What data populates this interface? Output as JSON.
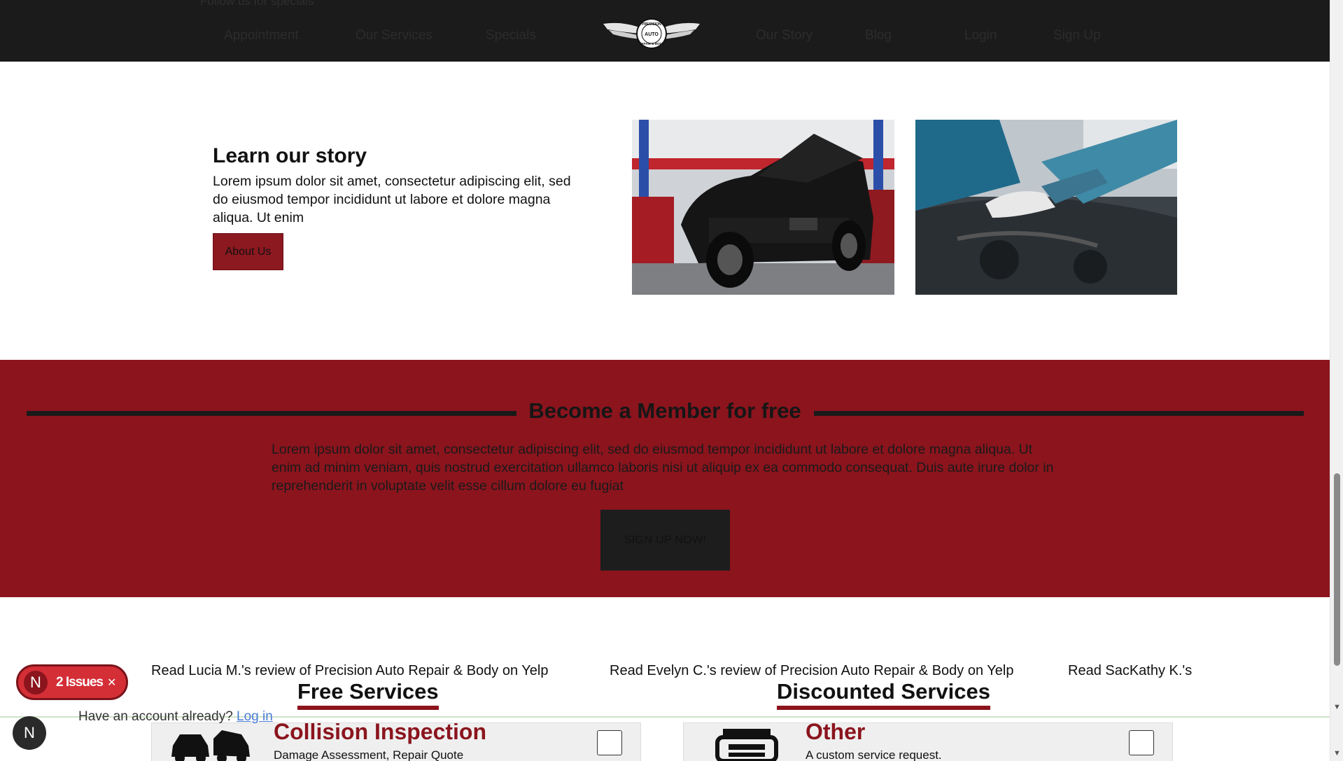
{
  "header": {
    "ghost_top_text": "Follow us for specials",
    "nav": [
      "Appointment",
      "Our Services",
      "Specials",
      "Our Story",
      "Blog",
      "Login",
      "Sign Up"
    ],
    "logo": {
      "ring_text": "PRECISION",
      "center_text": "AUTO",
      "bottom_text": "REPAIR & BODY"
    }
  },
  "story": {
    "title": "Learn our story",
    "text": "Lorem ipsum dolor sit amet, consectetur adipiscing elit, sed do eiusmod tempor incididunt ut labore et dolore magna aliqua. Ut enim",
    "button": "About Us"
  },
  "member": {
    "title": "Become a Member for free",
    "text": "Lorem ipsum dolor sit amet, consectetur adipiscing elit, sed do eiusmod tempor incididunt ut labore et dolore magna aliqua. Ut enim ad minim veniam, quis nostrud exercitation ullamco laboris nisi ut aliquip ex ea commodo consequat. Duis aute irure dolor in reprehenderit in voluptate velit esse cillum dolore eu fugiat",
    "button": "SIGN UP NOW!"
  },
  "reviews": [
    "Read Lucia M.'s review of Precision Auto Repair & Body on Yelp",
    "Read Evelyn C.'s review of Precision Auto Repair & Body on Yelp",
    "Read SacKathy K.'s"
  ],
  "services": {
    "free_title": "Free Services",
    "discount_title": "Discounted Services",
    "free_card": {
      "title": "Collision Inspection",
      "sub": "Damage Assessment, Repair Quote"
    },
    "discount_card": {
      "title": "Other",
      "sub": "A custom service request."
    }
  },
  "overlay": {
    "issue_badge_letter": "N",
    "issue_badge_label": "2 Issues",
    "fab_letter": "N",
    "ghost_text": "Have an account already?",
    "ghost_link": "Log in"
  },
  "colors": {
    "brand_red": "#8b141d",
    "header_dark": "#1b1b1b",
    "card_bg": "#efefef"
  }
}
